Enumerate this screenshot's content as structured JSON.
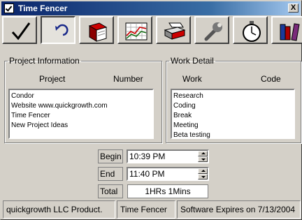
{
  "window": {
    "title": "Time Fencer",
    "close_label": "X"
  },
  "toolbar": {
    "buttons": [
      {
        "name": "check-icon"
      },
      {
        "name": "undo-icon"
      },
      {
        "name": "book-icon"
      },
      {
        "name": "chart-icon"
      },
      {
        "name": "printer-icon"
      },
      {
        "name": "wrench-icon"
      },
      {
        "name": "stopwatch-icon"
      },
      {
        "name": "books-icon"
      }
    ]
  },
  "project": {
    "legend": "Project Information",
    "col_project": "Project",
    "col_number": "Number",
    "items": [
      "Condor",
      "Website www.quickgrowth.com",
      "Time Fencer",
      "New Project Ideas"
    ]
  },
  "work": {
    "legend": "Work Detail",
    "col_work": "Work",
    "col_code": "Code",
    "items": [
      "Research",
      "Coding",
      "Break",
      "Meeting",
      "Beta testing"
    ]
  },
  "time": {
    "begin_label": "Begin",
    "begin_value": "10:39 PM",
    "end_label": "End",
    "end_value": "11:40 PM",
    "total_label": "Total",
    "total_value": "1HRs 1Mins"
  },
  "status": {
    "company": "quickgrowth LLC Product.",
    "app": "Time Fencer",
    "expiry": "Software Expires on 7/13/2004"
  },
  "colors": {
    "titlebar": "#0a246a",
    "face": "#d4d0c8"
  }
}
